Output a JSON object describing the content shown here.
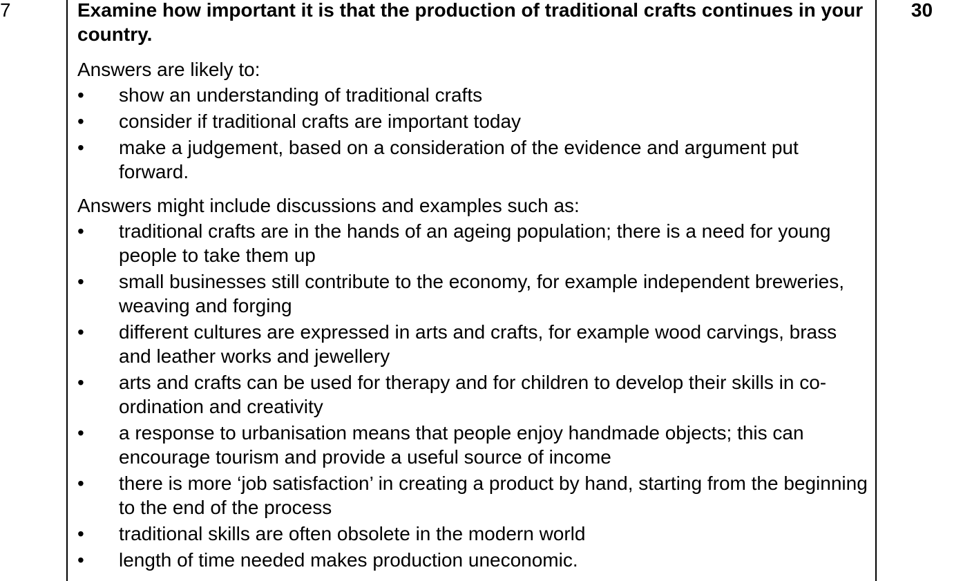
{
  "question": {
    "number": "7",
    "title": "Examine how important it is that the production of traditional crafts continues in your country.",
    "marks": "30"
  },
  "likely": {
    "intro": "Answers are likely to:",
    "items": [
      "show an understanding of traditional crafts",
      "consider if traditional crafts are important today",
      "make a judgement, based on a consideration of the evidence and argument put forward."
    ]
  },
  "examples": {
    "intro": "Answers might include discussions and examples such as:",
    "items": [
      "traditional crafts are in the hands of an ageing population; there is a need for young people to take them up",
      "small businesses still contribute to the economy, for example independent breweries, weaving and forging",
      "different cultures are expressed in arts and crafts, for example wood carvings, brass and leather works and jewellery",
      "arts and crafts can be used for therapy and for children to develop their skills in co-ordination and creativity",
      "a response to urbanisation means that people enjoy handmade objects; this can encourage tourism and provide a useful source of income",
      "there is more ‘job satisfaction’ in creating a product by hand, starting from the beginning to the end of the process",
      "traditional skills are often obsolete in the modern world",
      "length of time needed makes production uneconomic."
    ]
  },
  "bullet_glyph": "•"
}
